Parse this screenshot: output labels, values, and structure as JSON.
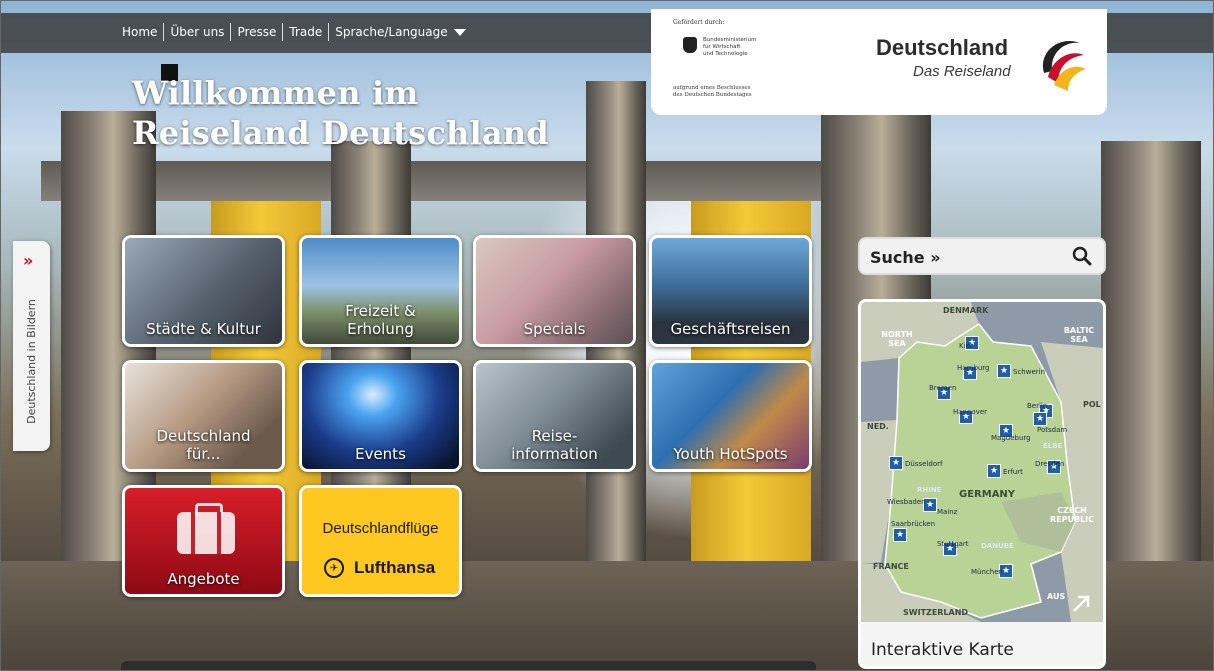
{
  "nav": {
    "items": [
      "Home",
      "Über uns",
      "Presse",
      "Trade",
      "Sprache/Language"
    ]
  },
  "logo": {
    "gefoerdert": "Gefördert durch:",
    "ministry": [
      "Bundesministerium",
      "für Wirtschaft",
      "und Technologie"
    ],
    "beschluss": [
      "aufgrund eines Beschlusses",
      "des Deutschen Bundestages"
    ],
    "title": "Deutschland",
    "subtitle": "Das Reiseland"
  },
  "headline": [
    "Willkommen im",
    "Reiseland Deutschland"
  ],
  "sidetab": {
    "chevron": "»",
    "label": "Deutschland in Bildern"
  },
  "tiles": [
    {
      "label": [
        "Städte & Kultur"
      ]
    },
    {
      "label": [
        "Freizeit &",
        "Erholung"
      ]
    },
    {
      "label": [
        "Specials"
      ]
    },
    {
      "label": [
        "Geschäftsreisen"
      ]
    },
    {
      "label": [
        "Deutschland",
        "für..."
      ]
    },
    {
      "label": [
        "Events"
      ]
    },
    {
      "label": [
        "Reise-",
        "information"
      ]
    },
    {
      "label": [
        "Youth HotSpots"
      ]
    },
    {
      "label": [
        "Angebote"
      ]
    },
    {
      "top": "Deutschlandflüge",
      "brand": "Lufthansa"
    }
  ],
  "search": {
    "label": "Suche »",
    "icon": "search-icon"
  },
  "map": {
    "caption": "Interaktive Karte",
    "regions": [
      "DENMARK",
      "NORTH SEA",
      "BALTIC SEA",
      "POL",
      "NED.",
      "GERMANY",
      "CZECH REPUBLIC",
      "FRANCE",
      "SWITZERLAND",
      "AUS"
    ],
    "cities": [
      "Kiel",
      "Hamburg",
      "Schwerin",
      "Bremen",
      "Hannover",
      "Berlin",
      "Potsdam",
      "Magdeburg",
      "Düsseldorf",
      "Erfurt",
      "Dresden",
      "Wiesbaden",
      "Mainz",
      "Saarbrücken",
      "Stuttgart",
      "München"
    ],
    "rivers": [
      "RHINE",
      "ELBE",
      "DANUBE"
    ]
  },
  "colors": {
    "accent_red": "#c8102e",
    "lufthansa_yellow": "#ffc820",
    "map_marker": "#1f5fa8"
  }
}
